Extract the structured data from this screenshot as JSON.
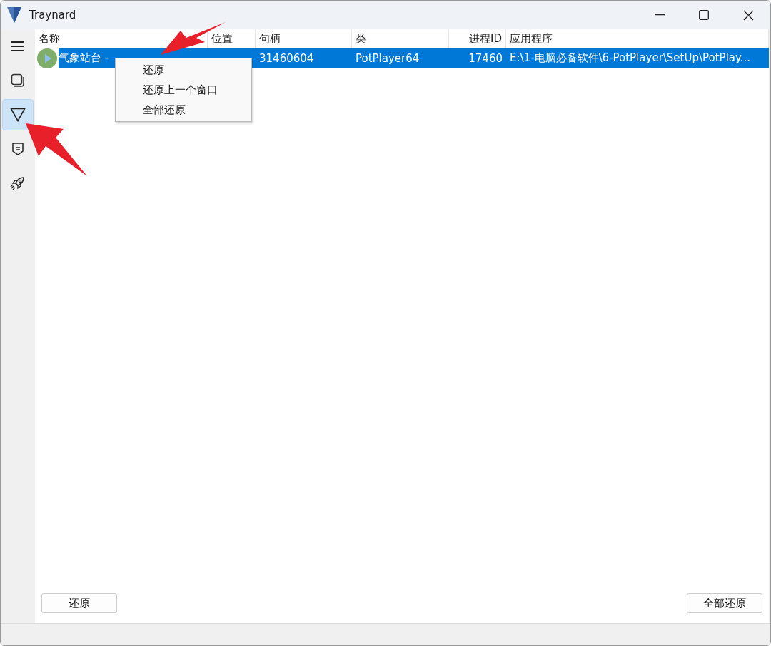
{
  "window": {
    "title": "Traynard"
  },
  "sidebar": {
    "items": [
      {
        "kind": "menu",
        "selected": false
      },
      {
        "kind": "windows",
        "selected": false
      },
      {
        "kind": "filter",
        "selected": true
      },
      {
        "kind": "badge",
        "selected": false
      },
      {
        "kind": "rocket",
        "selected": false
      }
    ]
  },
  "table": {
    "columns": [
      "名称",
      "位置",
      "句柄",
      "类",
      "进程ID",
      "应用程序"
    ],
    "rows": [
      {
        "selected": true,
        "name": "气象站台 - ",
        "handle": "31460604",
        "class": "PotPlayer64",
        "pid": "17460",
        "app": "E:\\1-电脑必备软件\\6-PotPlayer\\SetUp\\PotPlay..."
      }
    ]
  },
  "context_menu": {
    "items": [
      "还原",
      "还原上一个窗口",
      "全部还原"
    ]
  },
  "buttons": {
    "left": "还原",
    "right": "全部还原"
  }
}
